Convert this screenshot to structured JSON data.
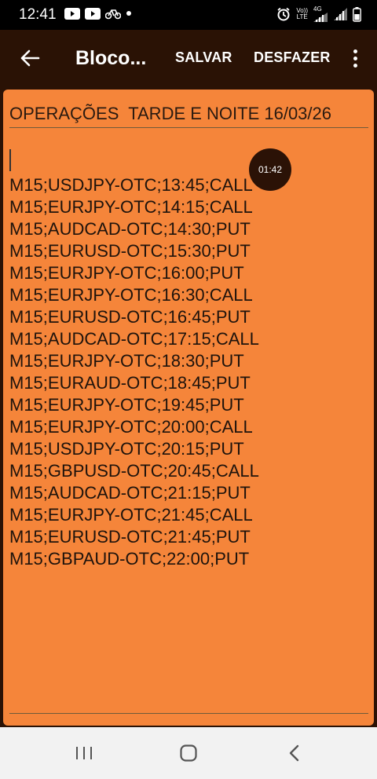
{
  "status_bar": {
    "time": "12:41",
    "network_label_top": "Vo))",
    "network_label_bottom": "LTE",
    "network_type": "4G",
    "left_icons": [
      "youtube-icon",
      "youtube-icon",
      "bike-icon",
      "dot-icon"
    ],
    "right_icons": [
      "alarm-icon",
      "volte-icon",
      "signal-icon",
      "signal-icon",
      "battery-icon"
    ]
  },
  "app_bar": {
    "title": "Bloco...",
    "save_label": "SALVAR",
    "undo_label": "DESFAZER"
  },
  "note": {
    "title": "OPERAÇÕES  TARDE E NOITE 16/03/26",
    "lines": [
      "M15;USDJPY-OTC;13:45;CALL",
      "M15;EURJPY-OTC;14:15;CALL",
      "M15;AUDCAD-OTC;14:30;PUT",
      "M15;EURUSD-OTC;15:30;PUT",
      "M15;EURJPY-OTC;16:00;PUT",
      "M15;EURJPY-OTC;16:30;CALL",
      "M15;EURUSD-OTC;16:45;PUT",
      "M15;AUDCAD-OTC;17:15;CALL",
      "M15;EURJPY-OTC;18:30;PUT",
      "M15;EURAUD-OTC;18:45;PUT",
      "M15;EURJPY-OTC;19:45;PUT",
      "M15;EURJPY-OTC;20:00;CALL",
      "M15;USDJPY-OTC;20:15;PUT",
      "M15;GBPUSD-OTC;20:45;CALL",
      "M15;AUDCAD-OTC;21:15;PUT",
      "M15;EURJPY-OTC;21:45;CALL",
      "M15;EURUSD-OTC;21:45;PUT",
      "M15;GBPAUD-OTC;22:00;PUT"
    ]
  },
  "timer": {
    "label": "01:42"
  },
  "colors": {
    "app_bar": "#2a1205",
    "note_background": "#f5853a",
    "nav_bar": "#f2f2f2"
  }
}
